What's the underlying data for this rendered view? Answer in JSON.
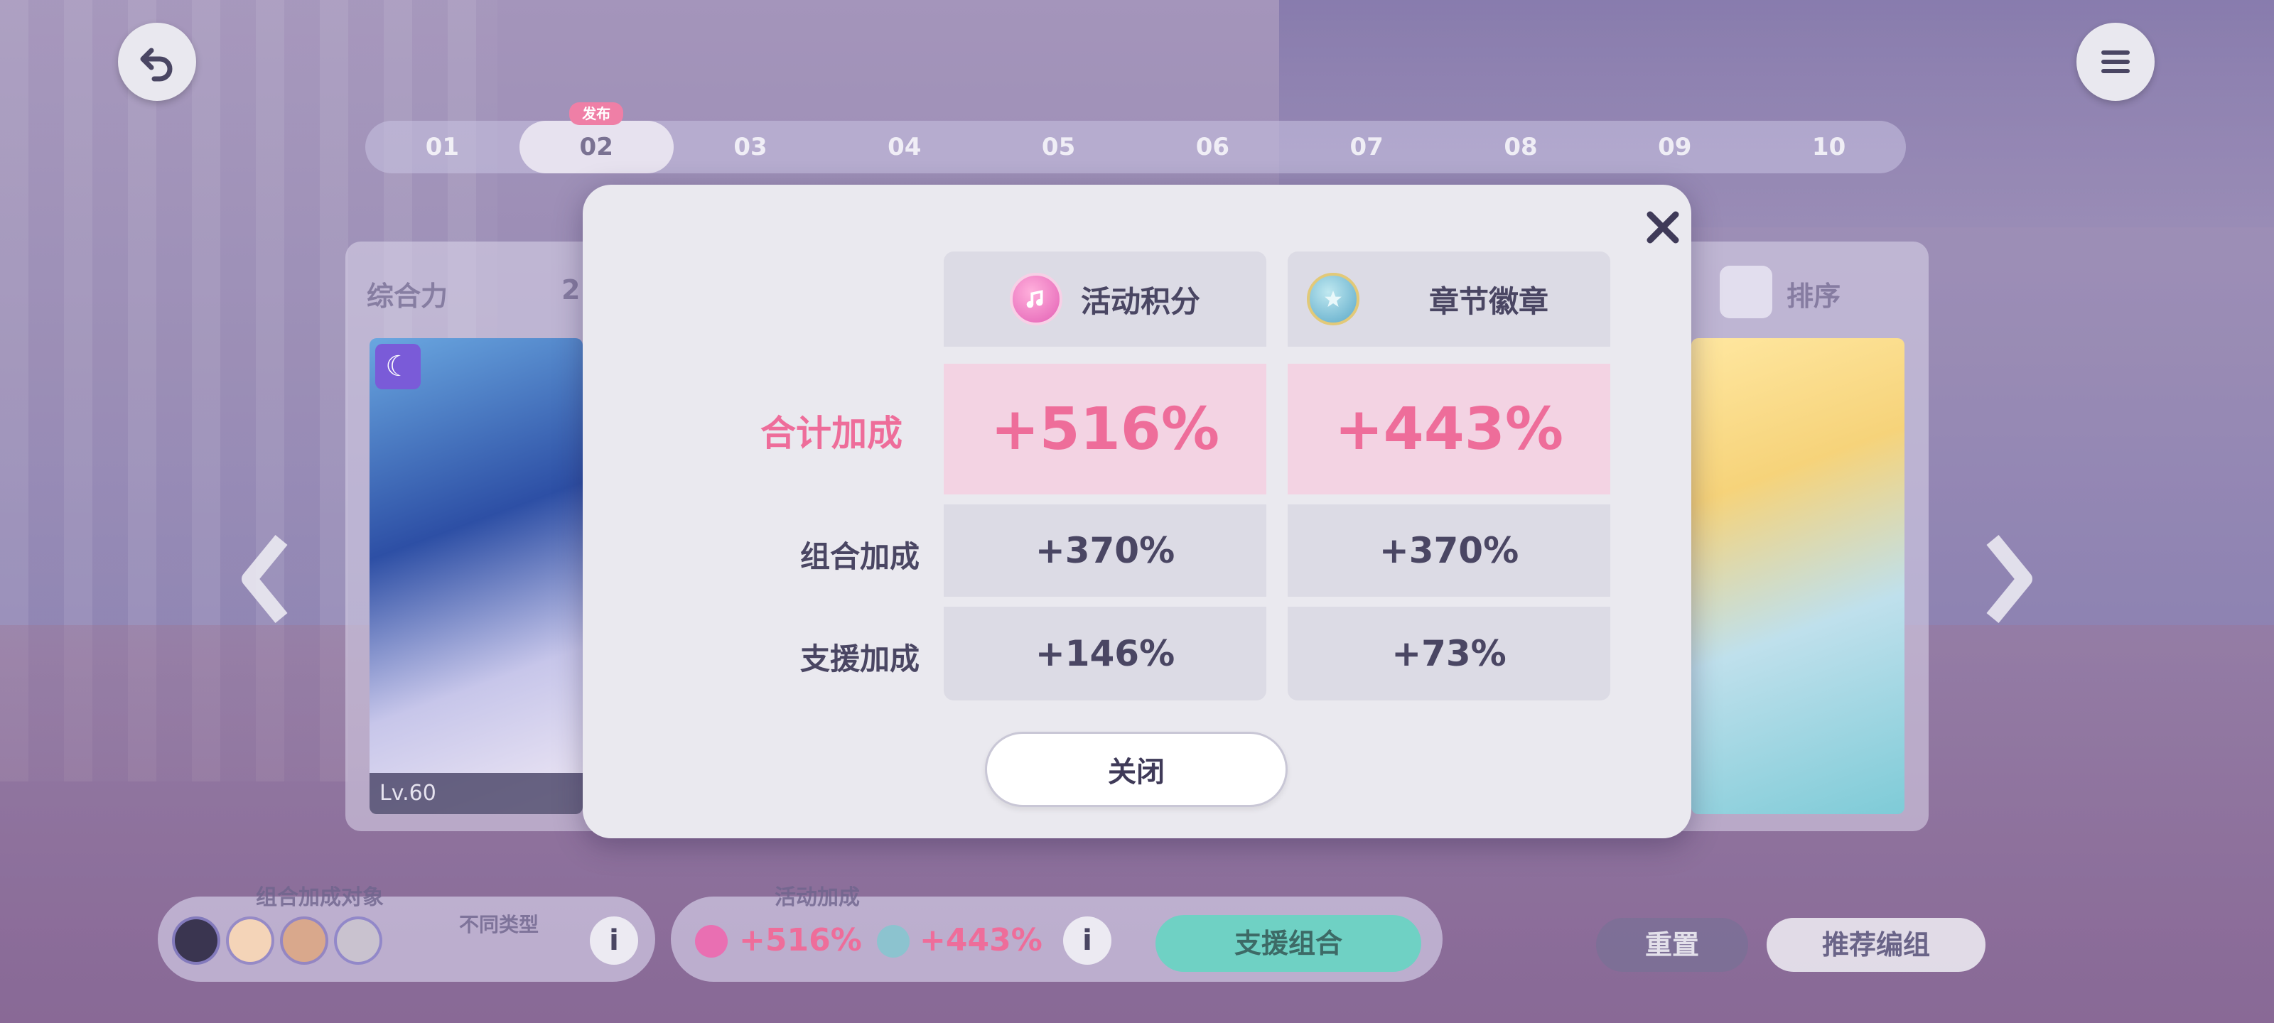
{
  "background": {
    "tabs": [
      "01",
      "02",
      "03",
      "04",
      "05",
      "06",
      "07",
      "08",
      "09",
      "10"
    ],
    "active_tab_index": 1,
    "active_tab_badge": "发布",
    "left_panel_label": "综合力",
    "left_panel_value": "2",
    "right_panel_label": "排序",
    "left_card_level": "Lv.60",
    "bottom": {
      "unit_bonus_label": "组合加成对象",
      "type_label": "不同类型",
      "event_bonus_label": "活动加成",
      "event_points_bonus": "+516%",
      "badge_bonus": "+443%",
      "support_unit_button": "支援组合",
      "reset_button": "重置",
      "recommend_button": "推荐编组"
    }
  },
  "modal": {
    "columns": [
      {
        "title": "活动积分",
        "icon": "event-points-icon",
        "icon_color": "#e35fb4"
      },
      {
        "title": "章节徽章",
        "icon": "chapter-badge-icon",
        "icon_color": "#5aa8c8"
      }
    ],
    "rows": [
      {
        "label": "合计加成",
        "values": [
          "+516%",
          "+443%"
        ]
      },
      {
        "label": "组合加成",
        "values": [
          "+370%",
          "+370%"
        ]
      },
      {
        "label": "支援加成",
        "values": [
          "+146%",
          "+73%"
        ]
      }
    ],
    "close_button": "关闭"
  },
  "colors": {
    "accent_pink": "#ee6d9a",
    "support_button": "#6fd1c4",
    "text_dark": "#4a4663"
  }
}
